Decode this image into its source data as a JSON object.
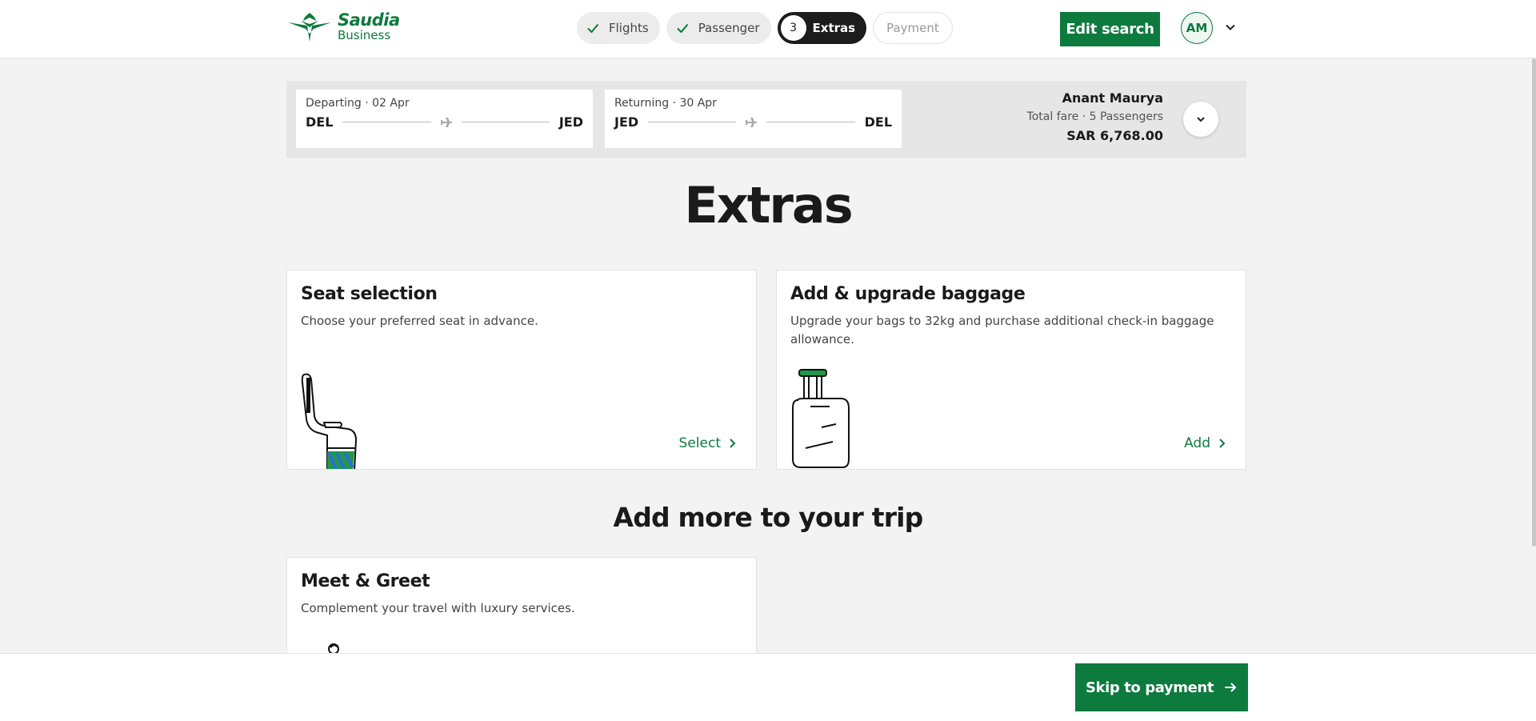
{
  "brand": {
    "line1": "Saudia",
    "line2": "Business"
  },
  "steps": [
    {
      "label": "Flights",
      "state": "done"
    },
    {
      "label": "Passenger",
      "state": "done"
    },
    {
      "label": "Extras",
      "number": "3",
      "state": "active"
    },
    {
      "label": "Payment",
      "state": "pending"
    }
  ],
  "header": {
    "edit_search": "Edit search",
    "avatar_initials": "AM"
  },
  "trip": {
    "departing": {
      "label": "Departing · 02 Apr",
      "from": "DEL",
      "to": "JED"
    },
    "returning": {
      "label": "Returning · 30 Apr",
      "from": "JED",
      "to": "DEL"
    },
    "passenger_name": "Anant Maurya",
    "fare_label": "Total fare · 5 Passengers",
    "fare_amount": "SAR 6,768.00"
  },
  "page_title": "Extras",
  "cards": {
    "seat": {
      "title": "Seat selection",
      "desc": "Choose your preferred seat in advance.",
      "action": "Select"
    },
    "baggage": {
      "title": "Add & upgrade baggage",
      "desc": "Upgrade your bags to 32kg and purchase additional check-in baggage allowance.",
      "action": "Add"
    },
    "meet": {
      "title": "Meet & Greet",
      "desc": "Complement your travel with luxury services."
    }
  },
  "more_title": "Add more to your trip",
  "footer": {
    "skip": "Skip to payment"
  },
  "colors": {
    "brand_green": "#0d7a3e",
    "active_step": "#1c1c1c"
  }
}
